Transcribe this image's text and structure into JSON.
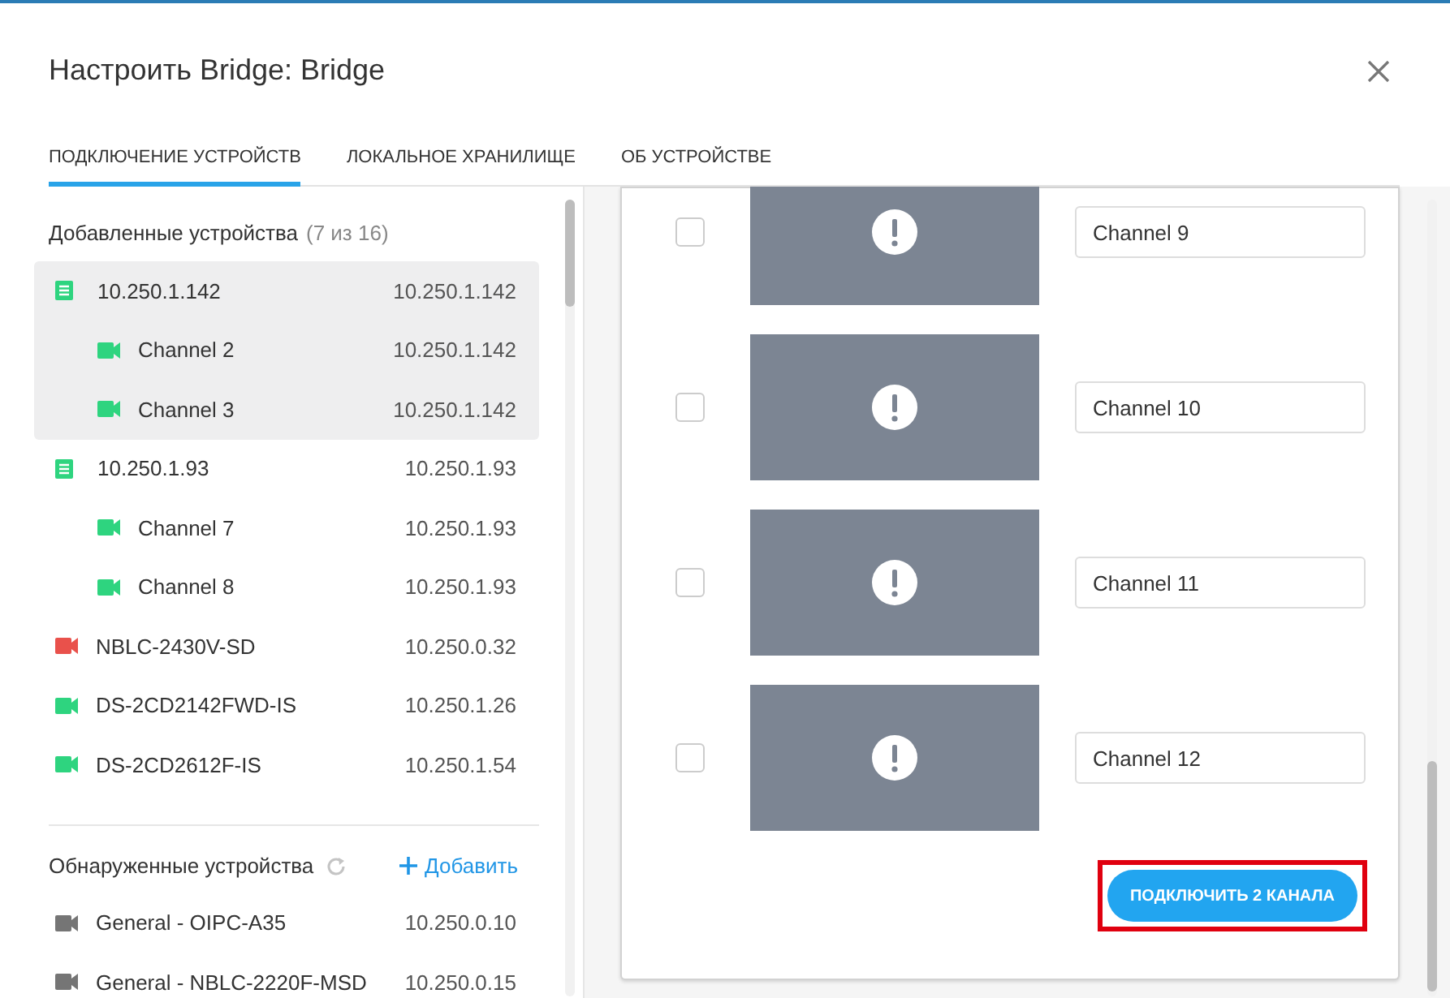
{
  "dialog": {
    "title": "Настроить Bridge: Bridge"
  },
  "tabs": [
    {
      "label": "ПОДКЛЮЧЕНИЕ УСТРОЙСТВ",
      "selected": true
    },
    {
      "label": "ЛОКАЛЬНОЕ ХРАНИЛИЩЕ",
      "selected": false
    },
    {
      "label": "ОБ УСТРОЙСТВЕ",
      "selected": false
    }
  ],
  "added_devices": {
    "heading": "Добавленные устройства",
    "count": "(7 из 16)",
    "items": [
      {
        "kind": "recorder",
        "name": "10.250.1.142",
        "address": "10.250.1.142",
        "color": "#2ed47f",
        "selected": true,
        "children": [
          {
            "kind": "camera",
            "name": "Channel 2",
            "address": "10.250.1.142",
            "color": "#2ed47f"
          },
          {
            "kind": "camera",
            "name": "Channel 3",
            "address": "10.250.1.142",
            "color": "#2ed47f"
          }
        ]
      },
      {
        "kind": "recorder",
        "name": "10.250.1.93",
        "address": "10.250.1.93",
        "color": "#2ed47f",
        "selected": false,
        "children": [
          {
            "kind": "camera",
            "name": "Channel 7",
            "address": "10.250.1.93",
            "color": "#2ed47f"
          },
          {
            "kind": "camera",
            "name": "Channel 8",
            "address": "10.250.1.93",
            "color": "#2ed47f"
          }
        ]
      },
      {
        "kind": "camera",
        "name": "NBLC-2430V-SD",
        "address": "10.250.0.32",
        "color": "#e9514b",
        "selected": false
      },
      {
        "kind": "camera",
        "name": "DS-2CD2142FWD-IS",
        "address": "10.250.1.26",
        "color": "#2ed47f",
        "selected": false
      },
      {
        "kind": "camera",
        "name": "DS-2CD2612F-IS",
        "address": "10.250.1.54",
        "color": "#2ed47f",
        "selected": false
      }
    ]
  },
  "discovered_devices": {
    "heading": "Обнаруженные устройства",
    "add_link": "Добавить",
    "items": [
      {
        "kind": "camera",
        "name": "General - OIPC-A35",
        "address": "10.250.0.10",
        "color": "#757575"
      },
      {
        "kind": "camera",
        "name": "General - NBLC-2220F-MSD",
        "address": "10.250.0.15",
        "color": "#757575"
      }
    ]
  },
  "channels": [
    {
      "name": "Channel 9",
      "checked": false
    },
    {
      "name": "Channel 10",
      "checked": false
    },
    {
      "name": "Channel 11",
      "checked": false
    },
    {
      "name": "Channel 12",
      "checked": false
    }
  ],
  "connect_button": {
    "label": "ПОДКЛЮЧИТЬ 2 КАНАЛА",
    "highlighted": true
  }
}
